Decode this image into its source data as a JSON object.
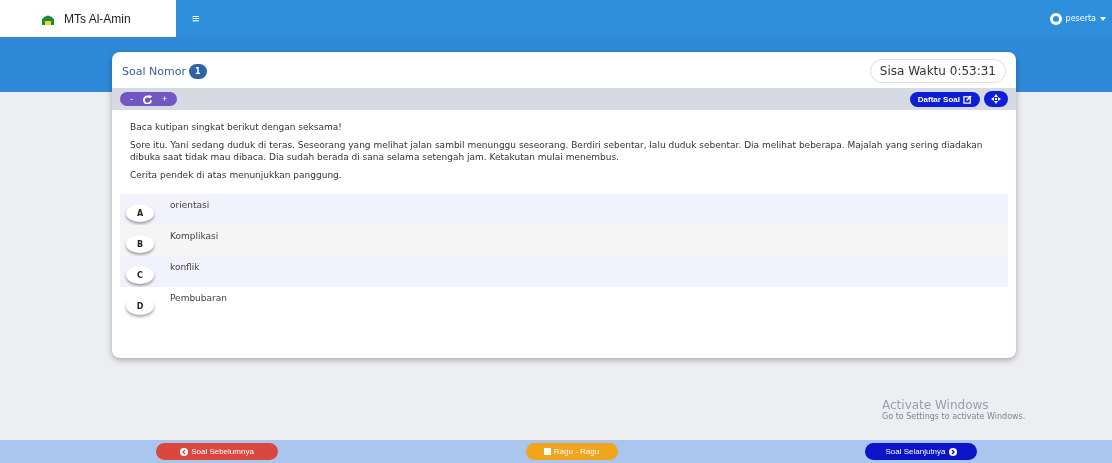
{
  "navbar": {
    "brand": "MTs Al-Amin",
    "menu_icon": "≡",
    "user": "peserta"
  },
  "card": {
    "title": "Soal Nomor",
    "number": "1",
    "timer": "Sisa Waktu 0:53:31",
    "toolbar": {
      "buttons": [
        "-",
        "+"
      ],
      "list_button": "Daftar Soal"
    },
    "question": [
      "Baca kutipan singkat berikut dengan seksama!",
      "Sore itu. Yani sedang duduk di teras. Seseorang yang melihat jalan sambil menunggu seseorang. Berdiri sebentar, lalu duduk sebentar. Dia melihat beberapa. Majalah yang sering diadakan dibuka saat tidak mau dibaca. Dia sudah berada di sana selama setengah jam. Ketakutan mulai menembus.",
      "Cerita pendek di atas menunjukkan panggung."
    ],
    "options": [
      {
        "letter": "A",
        "text": "orientasi",
        "selected": false
      },
      {
        "letter": "B",
        "text": "Komplikasi",
        "selected": false
      },
      {
        "letter": "C",
        "text": "konflik",
        "selected": false
      },
      {
        "letter": "D",
        "text": "Pembubaran",
        "selected": false
      }
    ]
  },
  "activation": {
    "title": "Activate Windows",
    "subtitle": "Go to Settings to activate Windows."
  },
  "footer": {
    "prev": "Soal Sebelumnya",
    "doubt": "Ragu - Ragu",
    "next": "Soal Selanjutnya"
  }
}
